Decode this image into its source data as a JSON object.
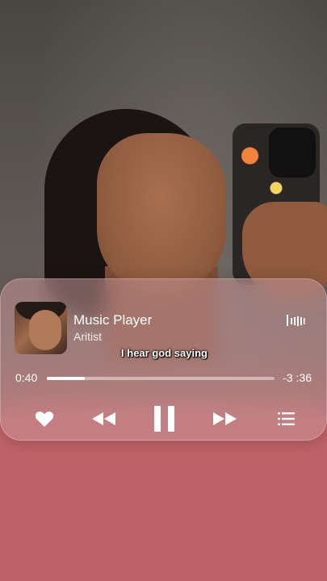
{
  "player": {
    "title": "Music Player",
    "artist": "Aritist",
    "lyric": "I hear god saying",
    "elapsed": "0:40",
    "remaining": "-3 :36",
    "progress": 0.165,
    "state": "playing"
  },
  "icons": {
    "wave": "sound-wave-icon",
    "like": "heart-icon",
    "previous": "rewind-icon",
    "play_pause": "pause-icon",
    "next": "fast-forward-icon",
    "queue": "list-icon"
  },
  "colors": {
    "card": "#c69698",
    "accent": "#ffffff",
    "shirt": "#c06368"
  }
}
